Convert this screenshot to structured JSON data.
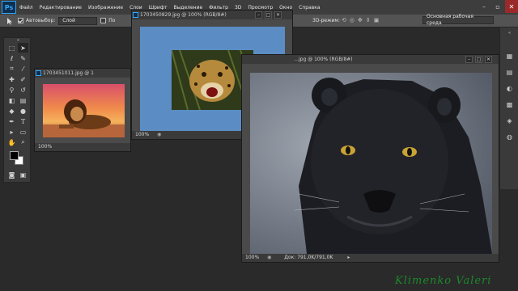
{
  "app": {
    "logo_text": "Ps"
  },
  "menubar": {
    "items": [
      "Файл",
      "Редактирование",
      "Изображение",
      "Слои",
      "Шрифт",
      "Выделение",
      "Фильтр",
      "3D",
      "Просмотр",
      "Окно",
      "Справка"
    ]
  },
  "window_controls": {
    "minimize": "–",
    "restore": "▫",
    "close": "✕"
  },
  "options_bar": {
    "auto_select_label": "Автовыбор:",
    "auto_select_value": "Слой",
    "show_controls_label": "По",
    "mode_3d_label": "3D-режим:",
    "workspace": "Основная рабочая среда"
  },
  "documents": {
    "lion": {
      "title": "1703451011.jpg @ 1",
      "zoom": "100%"
    },
    "leopard": {
      "title": "1703450829.jpg @ 100% (RGB/8#)",
      "zoom": "100%"
    },
    "panther": {
      "title": "…jpg @ 100% (RGB/8#)",
      "zoom": "100%",
      "doc_size": "Док: 791,0K/791,0K"
    }
  },
  "watermark": "Klimenko Valeri",
  "colors": {
    "ui_dark": "#2a2a2a",
    "panel": "#3a3a3a",
    "options_bar": "#535353",
    "leopard_canvas_bg": "#5b8cc4",
    "watermark": "#1a8a2a"
  }
}
